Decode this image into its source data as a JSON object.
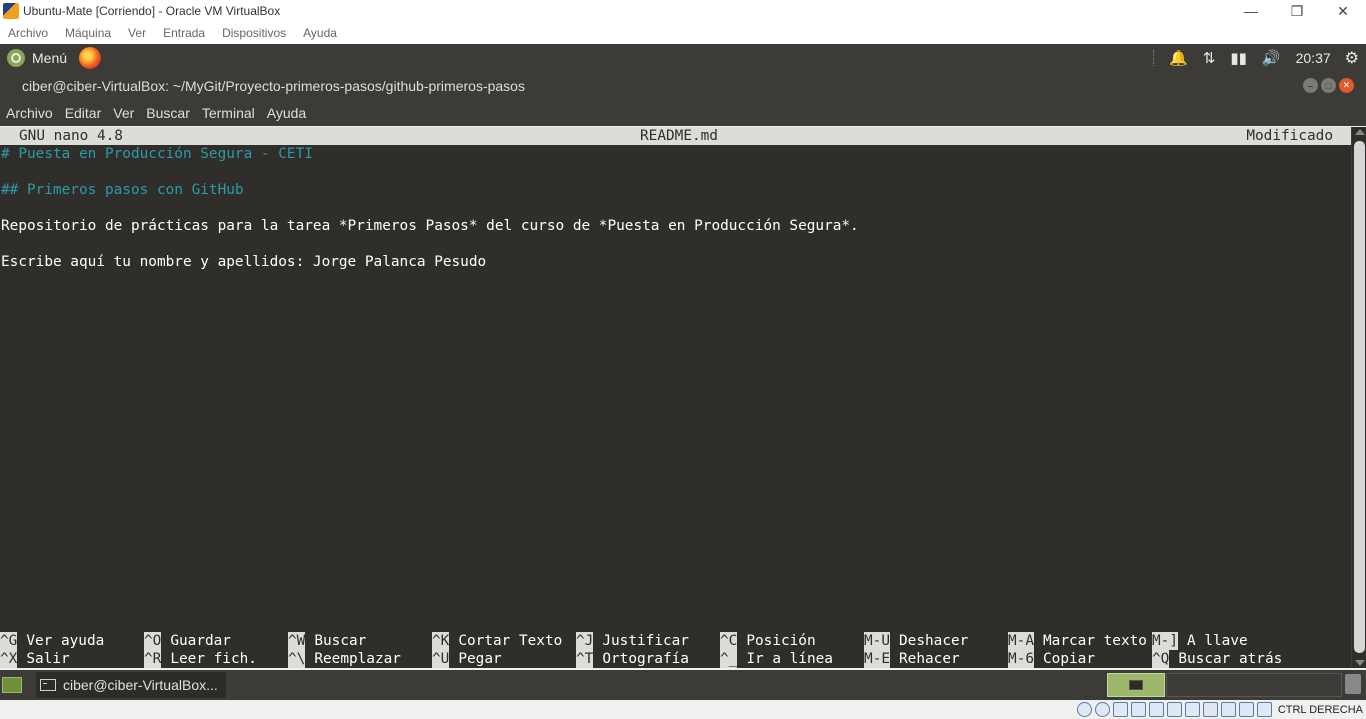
{
  "host": {
    "title": "Ubuntu-Mate [Corriendo] - Oracle VM VirtualBox",
    "menu": [
      "Archivo",
      "Máquina",
      "Ver",
      "Entrada",
      "Dispositivos",
      "Ayuda"
    ],
    "host_key_label": "CTRL DERECHA"
  },
  "guest_panel": {
    "menu_label": "Menú",
    "clock": "20:37"
  },
  "terminal": {
    "title": "ciber@ciber-VirtualBox: ~/MyGit/Proyecto-primeros-pasos/github-primeros-pasos",
    "menu": [
      "Archivo",
      "Editar",
      "Ver",
      "Buscar",
      "Terminal",
      "Ayuda"
    ]
  },
  "nano": {
    "version": "GNU nano 4.8",
    "filename": "README.md",
    "status": "Modificado",
    "lines": [
      "# Puesta en Producción Segura - CETI",
      "",
      "## Primeros pasos con GitHub",
      "",
      "Repositorio de prácticas para la tarea *Primeros Pasos* del curso de *Puesta en Producción Segura*.",
      "",
      "Escribe aquí tu nombre y apellidos: Jorge Palanca Pesudo"
    ],
    "shortcuts_row1": [
      {
        "key": "^G",
        "label": "Ver ayuda"
      },
      {
        "key": "^O",
        "label": "Guardar"
      },
      {
        "key": "^W",
        "label": "Buscar"
      },
      {
        "key": "^K",
        "label": "Cortar Texto"
      },
      {
        "key": "^J",
        "label": "Justificar"
      },
      {
        "key": "^C",
        "label": "Posición"
      },
      {
        "key": "M-U",
        "label": "Deshacer"
      },
      {
        "key": "M-A",
        "label": "Marcar texto"
      },
      {
        "key": "M-]",
        "label": "A llave"
      }
    ],
    "shortcuts_row2": [
      {
        "key": "^X",
        "label": "Salir"
      },
      {
        "key": "^R",
        "label": "Leer fich."
      },
      {
        "key": "^\\",
        "label": "Reemplazar"
      },
      {
        "key": "^U",
        "label": "Pegar"
      },
      {
        "key": "^T",
        "label": "Ortografía"
      },
      {
        "key": "^_",
        "label": "Ir a línea"
      },
      {
        "key": "M-E",
        "label": "Rehacer"
      },
      {
        "key": "M-6",
        "label": "Copiar"
      },
      {
        "key": "^Q",
        "label": "Buscar atrás"
      }
    ]
  },
  "taskbar": {
    "item_label": "ciber@ciber-VirtualBox..."
  }
}
